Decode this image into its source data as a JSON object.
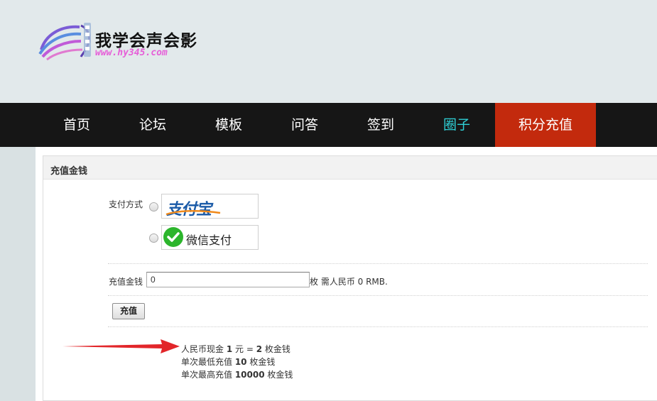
{
  "header": {
    "logo_title": "我学会声会影",
    "logo_url": "www.hy345.com"
  },
  "nav": {
    "items": [
      {
        "label": "首页"
      },
      {
        "label": "论坛"
      },
      {
        "label": "模板"
      },
      {
        "label": "问答"
      },
      {
        "label": "签到"
      },
      {
        "label": "圈子"
      },
      {
        "label": "积分充值"
      }
    ],
    "active_color": "#c32a0d",
    "highlight_color": "#2fd0d6"
  },
  "panel": {
    "title": "充值金钱",
    "payment_label": "支付方式",
    "payment_options": [
      {
        "label": "支付宝",
        "icon": "alipay-logo"
      },
      {
        "label": "微信支付",
        "icon": "wechat-pay-icon"
      }
    ],
    "amount_label": "充值金钱",
    "amount_value": "0",
    "amount_suffix": "枚 需人民币 0 RMB.",
    "submit_label": "充值",
    "info": {
      "rate_prefix": "人民币现金 ",
      "rate_rmb": "1",
      "rate_mid": " 元 = ",
      "rate_coins": "2",
      "rate_suffix": " 枚金钱",
      "min_prefix": "单次最低充值 ",
      "min_value": "10",
      "min_suffix": " 枚金钱",
      "max_prefix": "单次最高充值 ",
      "max_value": "10000",
      "max_suffix": " 枚金钱"
    }
  }
}
